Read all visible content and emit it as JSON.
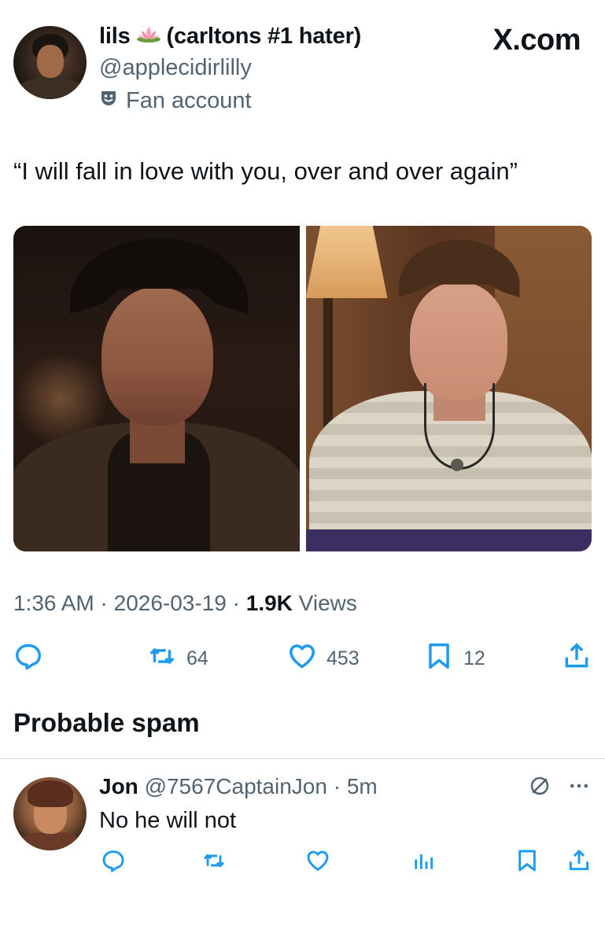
{
  "header": {
    "name_prefix": "lils",
    "name_suffix": "(carltons #1 hater)",
    "handle": "@applecidirlilly",
    "label": "Fan account",
    "brand": "X.com"
  },
  "tweet": {
    "text": "“I will fall in love with you, over and over again”",
    "time": "1:36 AM",
    "sep1": " · ",
    "date": "2026-03-19",
    "sep2": " · ",
    "views_count": "1.9K",
    "views_label": " Views"
  },
  "actions": {
    "retweets": "64",
    "likes": "453",
    "bookmarks": "12"
  },
  "section": {
    "spam_title": "Probable spam"
  },
  "reply": {
    "name": "Jon",
    "handle": "@7567CaptainJon",
    "dot": " · ",
    "time": "5m",
    "text": "No he will not"
  },
  "icons": {
    "lotus": "lotus-emoji-icon",
    "badge": "fan-account-badge-icon",
    "reply": "reply-icon",
    "retweet": "retweet-icon",
    "like": "heart-icon",
    "bookmark": "bookmark-icon",
    "share": "share-icon",
    "views": "views-chart-icon",
    "spam": "spam-marked-icon",
    "more": "more-icon"
  },
  "colors": {
    "text": "#0f1419",
    "secondary": "#536471",
    "divider": "#cfd9de"
  }
}
